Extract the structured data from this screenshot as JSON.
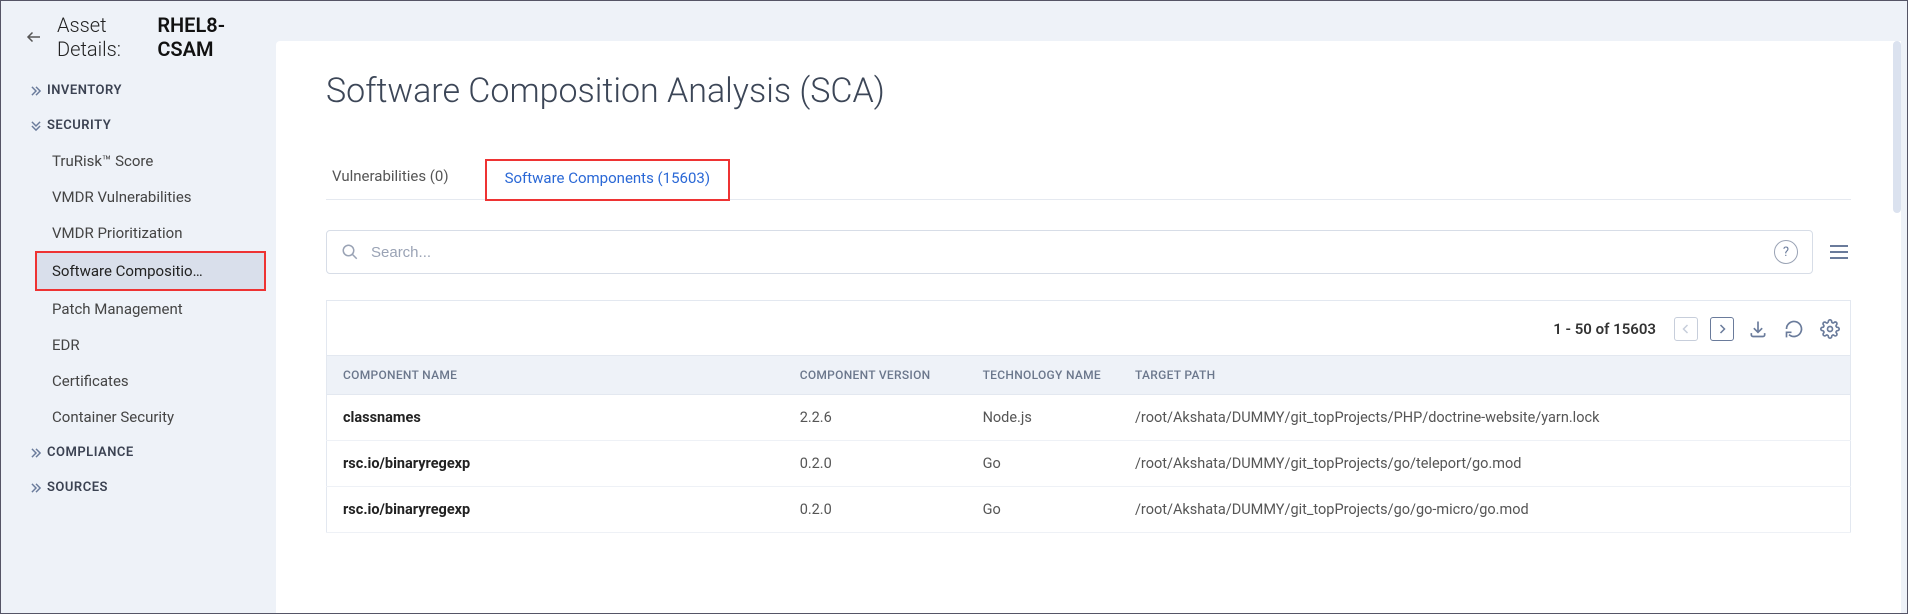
{
  "header": {
    "asset_label": "Asset Details:",
    "asset_name": "RHEL8-CSAM"
  },
  "sidebar": {
    "inventory_label": "INVENTORY",
    "security_label": "SECURITY",
    "security_items": [
      "TruRisk™ Score",
      "VMDR Vulnerabilities",
      "VMDR Prioritization",
      "Software Compositio…",
      "Patch Management",
      "EDR",
      "Certificates",
      "Container Security"
    ],
    "compliance_label": "COMPLIANCE",
    "sources_label": "SOURCES"
  },
  "main": {
    "title": "Software Composition Analysis (SCA)",
    "tabs": {
      "vulnerabilities": "Vulnerabilities (0)",
      "components": "Software Components (15603)"
    },
    "search": {
      "placeholder": "Search..."
    },
    "pager": {
      "text": "1 - 50 of 15603"
    },
    "table": {
      "columns": {
        "name": "COMPONENT NAME",
        "version": "COMPONENT VERSION",
        "tech": "TECHNOLOGY NAME",
        "path": "TARGET PATH"
      },
      "rows": [
        {
          "name": "classnames",
          "version": "2.2.6",
          "tech": "Node.js",
          "path": "/root/Akshata/DUMMY/git_topProjects/PHP/doctrine-website/yarn.lock"
        },
        {
          "name": "rsc.io/binaryregexp",
          "version": "0.2.0",
          "tech": "Go",
          "path": "/root/Akshata/DUMMY/git_topProjects/go/teleport/go.mod"
        },
        {
          "name": "rsc.io/binaryregexp",
          "version": "0.2.0",
          "tech": "Go",
          "path": "/root/Akshata/DUMMY/git_topProjects/go/go-micro/go.mod"
        }
      ]
    }
  }
}
